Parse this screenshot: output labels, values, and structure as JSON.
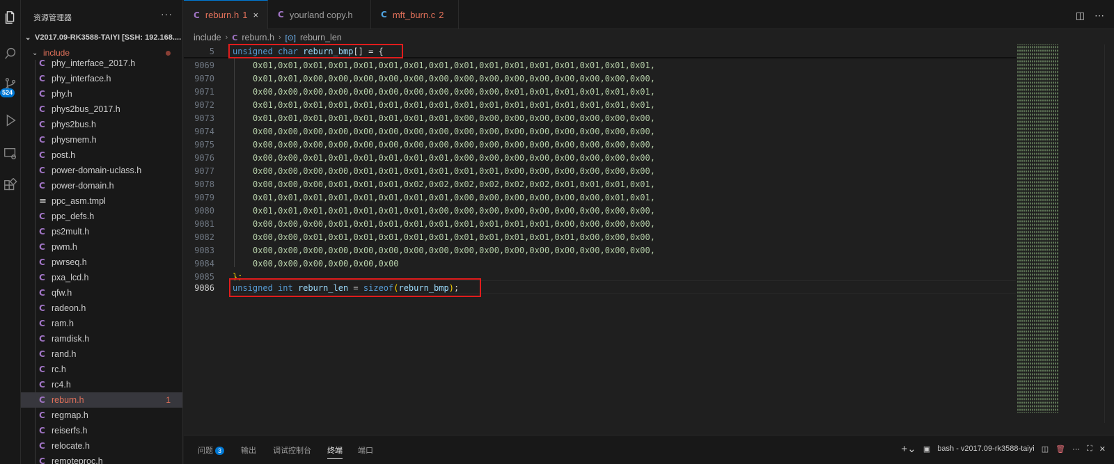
{
  "sidebar": {
    "title": "资源管理器",
    "more": "···",
    "root": "V2017.09-RK3588-TAIYI [SSH: 192.168....",
    "folder": "include",
    "files": [
      {
        "name": "phy_interface_2017.h",
        "icon": "C"
      },
      {
        "name": "phy_interface.h",
        "icon": "C"
      },
      {
        "name": "phy.h",
        "icon": "C"
      },
      {
        "name": "phys2bus_2017.h",
        "icon": "C"
      },
      {
        "name": "phys2bus.h",
        "icon": "C"
      },
      {
        "name": "physmem.h",
        "icon": "C"
      },
      {
        "name": "post.h",
        "icon": "C"
      },
      {
        "name": "power-domain-uclass.h",
        "icon": "C"
      },
      {
        "name": "power-domain.h",
        "icon": "C"
      },
      {
        "name": "ppc_asm.tmpl",
        "icon": "≡"
      },
      {
        "name": "ppc_defs.h",
        "icon": "C"
      },
      {
        "name": "ps2mult.h",
        "icon": "C"
      },
      {
        "name": "pwm.h",
        "icon": "C"
      },
      {
        "name": "pwrseq.h",
        "icon": "C"
      },
      {
        "name": "pxa_lcd.h",
        "icon": "C"
      },
      {
        "name": "qfw.h",
        "icon": "C"
      },
      {
        "name": "radeon.h",
        "icon": "C"
      },
      {
        "name": "ram.h",
        "icon": "C"
      },
      {
        "name": "ramdisk.h",
        "icon": "C"
      },
      {
        "name": "rand.h",
        "icon": "C"
      },
      {
        "name": "rc.h",
        "icon": "C"
      },
      {
        "name": "rc4.h",
        "icon": "C"
      },
      {
        "name": "reburn.h",
        "icon": "C",
        "count": "1"
      },
      {
        "name": "regmap.h",
        "icon": "C"
      },
      {
        "name": "reiserfs.h",
        "icon": "C"
      },
      {
        "name": "relocate.h",
        "icon": "C"
      },
      {
        "name": "remoteproc.h",
        "icon": "C"
      }
    ]
  },
  "activity": {
    "badge": "524"
  },
  "tabs": [
    {
      "label": "reburn.h",
      "count": "1",
      "icon": "C",
      "close": "×"
    },
    {
      "label": "yourland copy.h",
      "icon": "C"
    },
    {
      "label": "mft_burn.c",
      "count": "2",
      "icon": "C"
    }
  ],
  "breadcrumb": {
    "folder": "include",
    "file": "reburn.h",
    "symbol": "reburn_len",
    "icon": "C"
  },
  "editor": {
    "sticky": {
      "num": "5",
      "kw1": "unsigned",
      "kw2": "char",
      "name": "reburn_bmp",
      "rest": "[] = {"
    },
    "hex_lines": [
      {
        "num": "9069",
        "text": "0x01,0x01,0x01,0x01,0x01,0x01,0x01,0x01,0x01,0x01,0x01,0x01,0x01,0x01,0x01,0x01,"
      },
      {
        "num": "9070",
        "text": "0x01,0x01,0x00,0x00,0x00,0x00,0x00,0x00,0x00,0x00,0x00,0x00,0x00,0x00,0x00,0x00,"
      },
      {
        "num": "9071",
        "text": "0x00,0x00,0x00,0x00,0x00,0x00,0x00,0x00,0x00,0x00,0x01,0x01,0x01,0x01,0x01,0x01,"
      },
      {
        "num": "9072",
        "text": "0x01,0x01,0x01,0x01,0x01,0x01,0x01,0x01,0x01,0x01,0x01,0x01,0x01,0x01,0x01,0x01,"
      },
      {
        "num": "9073",
        "text": "0x01,0x01,0x01,0x01,0x01,0x01,0x01,0x01,0x00,0x00,0x00,0x00,0x00,0x00,0x00,0x00,"
      },
      {
        "num": "9074",
        "text": "0x00,0x00,0x00,0x00,0x00,0x00,0x00,0x00,0x00,0x00,0x00,0x00,0x00,0x00,0x00,0x00,"
      },
      {
        "num": "9075",
        "text": "0x00,0x00,0x00,0x00,0x00,0x00,0x00,0x00,0x00,0x00,0x00,0x00,0x00,0x00,0x00,0x00,"
      },
      {
        "num": "9076",
        "text": "0x00,0x00,0x01,0x01,0x01,0x01,0x01,0x01,0x00,0x00,0x00,0x00,0x00,0x00,0x00,0x00,"
      },
      {
        "num": "9077",
        "text": "0x00,0x00,0x00,0x00,0x01,0x01,0x01,0x01,0x01,0x01,0x00,0x00,0x00,0x00,0x00,0x00,"
      },
      {
        "num": "9078",
        "text": "0x00,0x00,0x00,0x01,0x01,0x01,0x02,0x02,0x02,0x02,0x02,0x02,0x01,0x01,0x01,0x01,"
      },
      {
        "num": "9079",
        "text": "0x01,0x01,0x01,0x01,0x01,0x01,0x01,0x01,0x00,0x00,0x00,0x00,0x00,0x00,0x01,0x01,"
      },
      {
        "num": "9080",
        "text": "0x01,0x01,0x01,0x01,0x01,0x01,0x01,0x00,0x00,0x00,0x00,0x00,0x00,0x00,0x00,0x00,"
      },
      {
        "num": "9081",
        "text": "0x00,0x00,0x00,0x01,0x01,0x01,0x01,0x01,0x01,0x01,0x01,0x01,0x00,0x00,0x00,0x00,"
      },
      {
        "num": "9082",
        "text": "0x00,0x00,0x01,0x01,0x01,0x01,0x01,0x01,0x01,0x01,0x01,0x01,0x01,0x00,0x00,0x00,"
      },
      {
        "num": "9083",
        "text": "0x00,0x00,0x00,0x00,0x00,0x00,0x00,0x00,0x00,0x00,0x00,0x00,0x00,0x00,0x00,0x00,"
      },
      {
        "num": "9084",
        "text": "0x00,0x00,0x00,0x00,0x00,0x00"
      }
    ],
    "close_line": {
      "num": "9085",
      "text": "};"
    },
    "last_line": {
      "num": "9086",
      "kw1": "unsigned",
      "kw2": "int",
      "name": "reburn_len",
      "eq": " = ",
      "fn": "sizeof",
      "open": "(",
      "arg": "reburn_bmp",
      "close": ")",
      "semi": ";"
    }
  },
  "panel": {
    "tabs": [
      "问题",
      "输出",
      "调试控制台",
      "终端",
      "端口"
    ],
    "problems_count": "3",
    "active_tab": "终端",
    "terminal_name": "bash - v2017.09-rk3588-taiyi"
  },
  "colors": {
    "accent": "#0078d4",
    "highlight_box": "#e01c1c",
    "error": "#e2715a",
    "c_icon": "#a074c4"
  }
}
